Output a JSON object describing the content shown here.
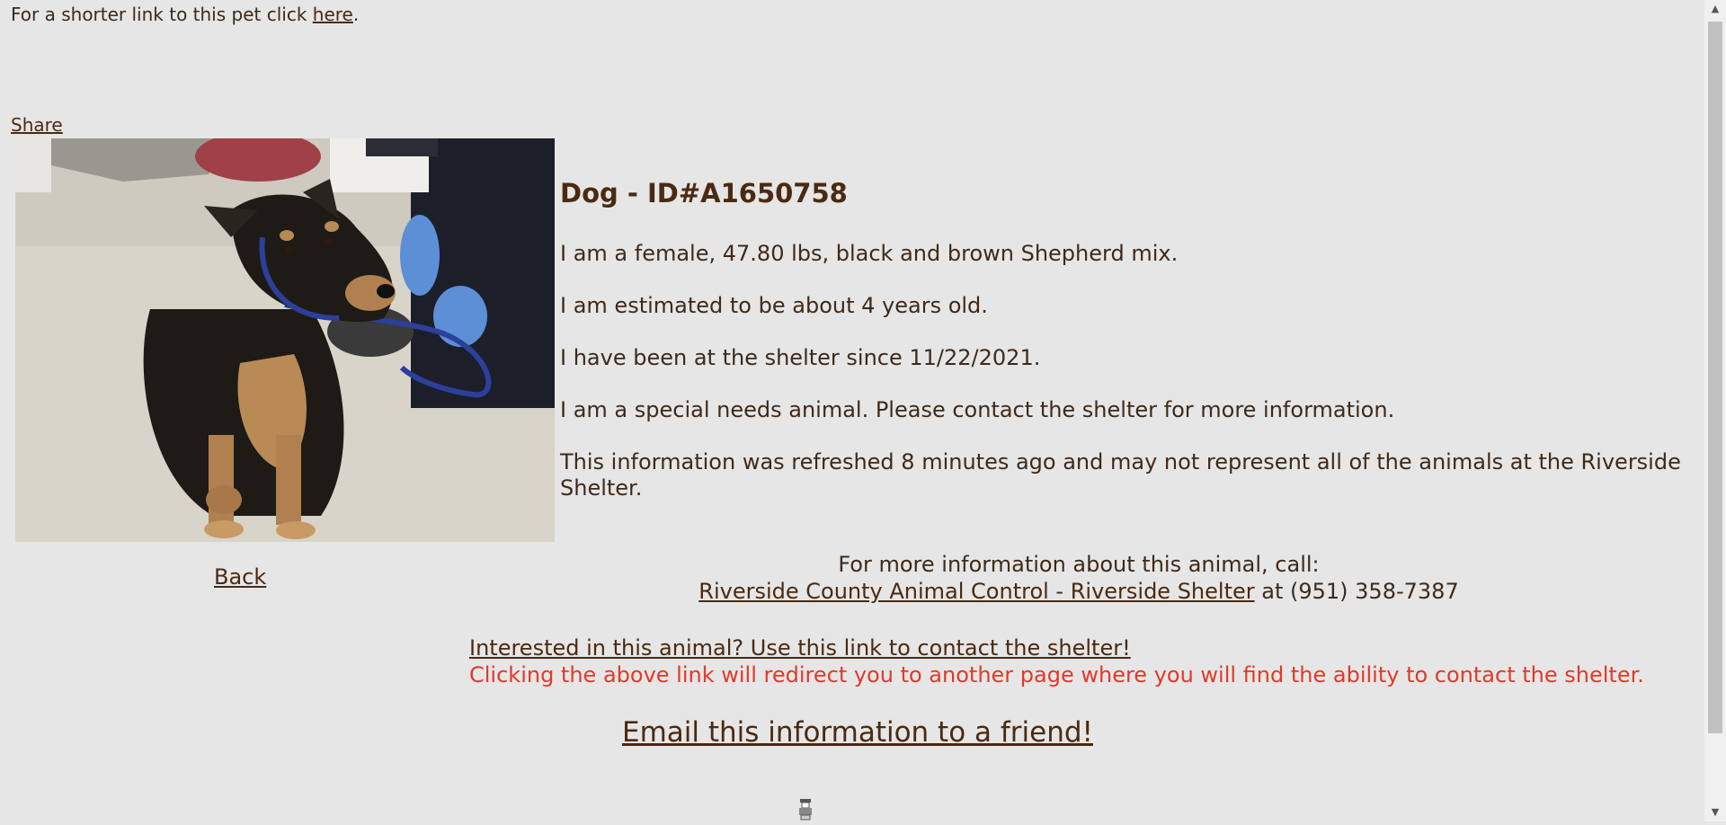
{
  "header": {
    "shortlink_text": "For a shorter link to this pet click ",
    "shortlink_link": "here",
    "shortlink_suffix": "."
  },
  "share_label": "Share",
  "back_label": "Back",
  "pet": {
    "title": "Dog - ID#A1650758",
    "description": "I am a female, 47.80 lbs, black and brown Shepherd mix.",
    "age": "I am estimated to be about 4 years old.",
    "shelter_since": "I have been at the shelter since 11/22/2021.",
    "special_needs": "I am a special needs animal. Please contact the shelter for more information.",
    "refresh_note": "This information was refreshed 8 minutes ago and may not represent all of the animals at the Riverside Shelter."
  },
  "contact": {
    "intro": "For more information about this animal, call:",
    "shelter_link": "Riverside County Animal Control - Riverside Shelter",
    "phone_text": " at (951) 358-7387"
  },
  "interest": {
    "link": "Interested in this animal? Use this link to contact the shelter!",
    "note": "Clicking the above link will redirect you to another page where you will find the ability to contact the shelter."
  },
  "email_link": "Email this information to a friend!",
  "icons": {
    "spinner": "loading-spinner-icon",
    "scroll_up": "scroll-up-arrow-icon",
    "scroll_down": "scroll-down-arrow-icon"
  }
}
